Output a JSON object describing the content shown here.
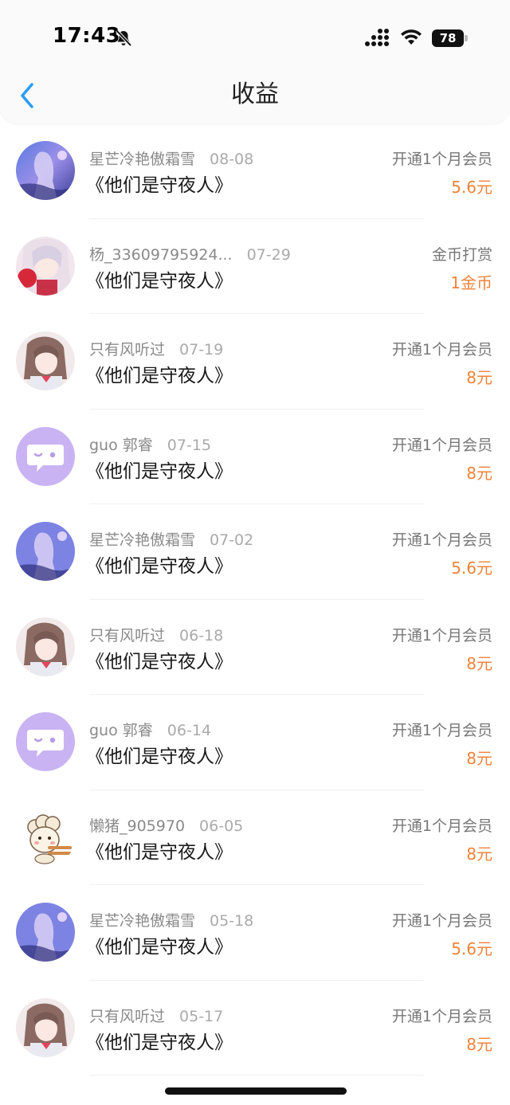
{
  "status": {
    "time": "17:43",
    "battery": "78"
  },
  "nav": {
    "title": "收益"
  },
  "colors": {
    "amount": "#f0833a",
    "back": "#2a9cf0",
    "avatar_purple": "#c9b3f3"
  },
  "rows": [
    {
      "avatar": "anime-girl-purple-sky",
      "name": "星芒冷艳傲霜雪",
      "date": "08-08",
      "title": "《他们是守夜人》",
      "type": "开通1个月会员",
      "amount": "5.6元"
    },
    {
      "avatar": "anime-girl-red-lantern",
      "name": "杨_33609795924...",
      "date": "07-29",
      "title": "《他们是守夜人》",
      "type": "金币打赏",
      "amount": "1金币"
    },
    {
      "avatar": "anime-girl-brown-hair",
      "name": "只有风听过",
      "date": "07-19",
      "title": "《他们是守夜人》",
      "type": "开通1个月会员",
      "amount": "8元"
    },
    {
      "avatar": "chat-bubble-icon",
      "name": "guo 郭睿",
      "date": "07-15",
      "title": "《他们是守夜人》",
      "type": "开通1个月会员",
      "amount": "8元"
    },
    {
      "avatar": "anime-girl-purple-sky",
      "name": "星芒冷艳傲霜雪",
      "date": "07-02",
      "title": "《他们是守夜人》",
      "type": "开通1个月会员",
      "amount": "5.6元"
    },
    {
      "avatar": "anime-girl-brown-hair",
      "name": "只有风听过",
      "date": "06-18",
      "title": "《他们是守夜人》",
      "type": "开通1个月会员",
      "amount": "8元"
    },
    {
      "avatar": "chat-bubble-icon",
      "name": "guo 郭睿",
      "date": "06-14",
      "title": "《他们是守夜人》",
      "type": "开通1个月会员",
      "amount": "8元"
    },
    {
      "avatar": "lazy-sheep-cartoon",
      "name": "懒猪_905970",
      "date": "06-05",
      "title": "《他们是守夜人》",
      "type": "开通1个月会员",
      "amount": "8元"
    },
    {
      "avatar": "anime-girl-purple-sky",
      "name": "星芒冷艳傲霜雪",
      "date": "05-18",
      "title": "《他们是守夜人》",
      "type": "开通1个月会员",
      "amount": "5.6元"
    },
    {
      "avatar": "anime-girl-brown-hair",
      "name": "只有风听过",
      "date": "05-17",
      "title": "《他们是守夜人》",
      "type": "开通1个月会员",
      "amount": "8元"
    }
  ]
}
